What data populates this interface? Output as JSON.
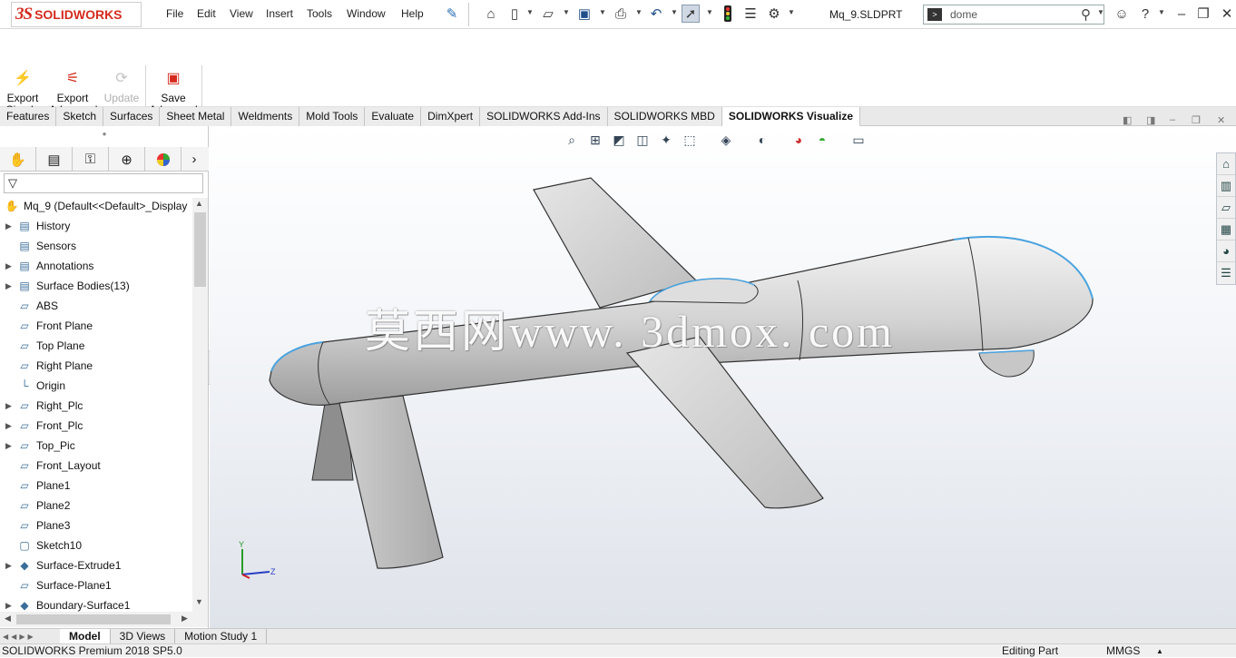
{
  "app": {
    "logo_prefix": "3S",
    "logo_text": "SOLIDWORKS",
    "document": "Mq_9.SLDPRT"
  },
  "menu": [
    "File",
    "Edit",
    "View",
    "Insert",
    "Tools",
    "Window",
    "Help"
  ],
  "search": {
    "value": "dome"
  },
  "ribbon": {
    "buttons": [
      {
        "line1": "Export",
        "line2": "Simple"
      },
      {
        "line1": "Export",
        "line2": "Advanced"
      },
      {
        "line1": "Update",
        "line2": ""
      },
      {
        "line1": "Save",
        "line2": "Advanced"
      }
    ]
  },
  "tabs": [
    "Features",
    "Sketch",
    "Surfaces",
    "Sheet Metal",
    "Weldments",
    "Mold Tools",
    "Evaluate",
    "DimXpert",
    "SOLIDWORKS Add-Ins",
    "SOLIDWORKS MBD",
    "SOLIDWORKS Visualize"
  ],
  "active_tab": "SOLIDWORKS Visualize",
  "tree": {
    "root": "Mq_9  (Default<<Default>_Display",
    "items": [
      {
        "label": "History",
        "expand": true
      },
      {
        "label": "Sensors",
        "expand": false
      },
      {
        "label": "Annotations",
        "expand": true
      },
      {
        "label": "Surface Bodies(13)",
        "expand": true
      },
      {
        "label": "ABS",
        "expand": false
      },
      {
        "label": "Front Plane",
        "expand": false
      },
      {
        "label": "Top Plane",
        "expand": false
      },
      {
        "label": "Right Plane",
        "expand": false
      },
      {
        "label": "Origin",
        "expand": false
      },
      {
        "label": "Right_Plc",
        "expand": true
      },
      {
        "label": "Front_Plc",
        "expand": true
      },
      {
        "label": "Top_Pic",
        "expand": true
      },
      {
        "label": "Front_Layout",
        "expand": false
      },
      {
        "label": "Plane1",
        "expand": false
      },
      {
        "label": "Plane2",
        "expand": false
      },
      {
        "label": "Plane3",
        "expand": false
      },
      {
        "label": "Sketch10",
        "expand": false
      },
      {
        "label": "Surface-Extrude1",
        "expand": true
      },
      {
        "label": "Surface-Plane1",
        "expand": false
      },
      {
        "label": "Boundary-Surface1",
        "expand": true
      }
    ]
  },
  "watermark": "莫西网www. 3dmox. com",
  "triad": {
    "y": "Y",
    "z": "Z"
  },
  "bottom_tabs": [
    "Model",
    "3D Views",
    "Motion Study 1"
  ],
  "status": {
    "version": "SOLIDWORKS Premium 2018 SP5.0",
    "mode": "Editing Part",
    "units": "MMGS"
  },
  "colors": {
    "brand": "#d52b1e",
    "body": "#c9c9c9",
    "edge_highlight": "#4aa3df"
  }
}
